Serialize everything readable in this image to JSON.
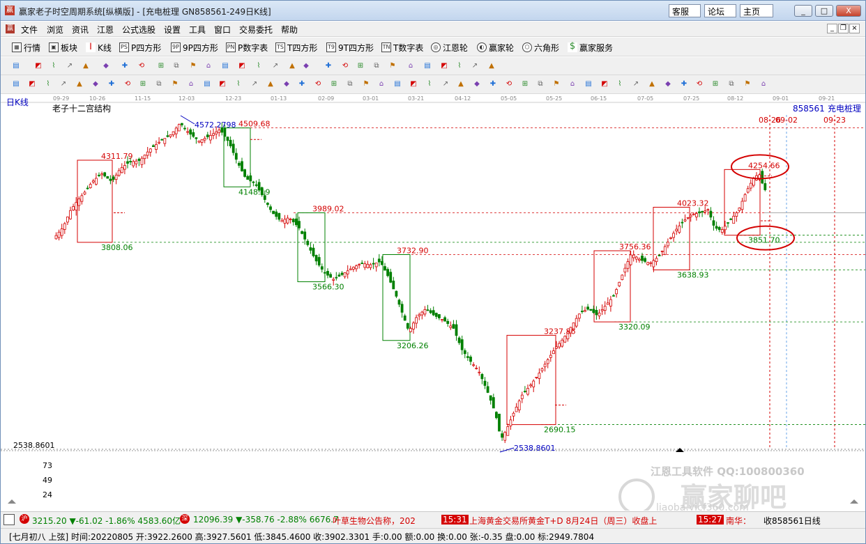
{
  "window": {
    "title": "赢家老子时空周期系统[纵横版] - [充电桩理   GN858561-249日K线]",
    "links": [
      "客服",
      "论坛",
      "主页"
    ],
    "controls": [
      "_",
      "□",
      "X"
    ]
  },
  "menu": [
    "文件",
    "浏览",
    "资讯",
    "江恩",
    "公式选股",
    "设置",
    "工具",
    "窗口",
    "交易委托",
    "帮助"
  ],
  "toolbar1": [
    {
      "label": "行情",
      "icon": "grid-icon"
    },
    {
      "label": "板块",
      "icon": "blocks-icon"
    },
    {
      "label": "K线",
      "icon": "candle-icon"
    },
    {
      "label": "P四方形",
      "icon": "ps-icon",
      "tag": "PS"
    },
    {
      "label": "9P四方形",
      "icon": "9p-icon",
      "tag": "9P"
    },
    {
      "label": "P数字表",
      "icon": "pn-icon",
      "tag": "PN"
    },
    {
      "label": "T四方形",
      "icon": "ts-icon",
      "tag": "TS"
    },
    {
      "label": "9T四方形",
      "icon": "9t-icon",
      "tag": "T9"
    },
    {
      "label": "T数字表",
      "icon": "tn-icon",
      "tag": "TN"
    },
    {
      "label": "江恩轮",
      "icon": "gann-wheel-icon",
      "tag": "◎"
    },
    {
      "label": "赢家轮",
      "icon": "winner-wheel-icon",
      "tag": "◐"
    },
    {
      "label": "六角形",
      "icon": "hexagon-icon",
      "tag": "⬡"
    },
    {
      "label": "赢家服务",
      "icon": "dollar-icon",
      "tag": "$"
    }
  ],
  "chart": {
    "period_label": "日K线",
    "indicator_title": "老子十二宫结构",
    "code": "858561",
    "name": "充电桩理",
    "date_ticks": [
      "09-29",
      "10-26",
      "11-15",
      "12-03",
      "12-23",
      "01-13",
      "02-09",
      "03-01",
      "03-21",
      "04-12",
      "05-05",
      "05-25",
      "06-15",
      "07-05",
      "07-25",
      "08-12",
      "09-01",
      "09-21"
    ],
    "future_dates": [
      "08-26",
      "09-02",
      "09-23"
    ],
    "y_bottom_label": "2538.8601",
    "sub_axis": [
      "73",
      "49",
      "24"
    ],
    "watermark1": "江恩工具软件  QQ:100800360",
    "watermark2": "赢家聊吧",
    "watermark3": "liaoba.yjcf360.com",
    "red_labels": [
      {
        "text": "4311.79"
      },
      {
        "text": "4509.68"
      },
      {
        "text": "3989.02"
      },
      {
        "text": "3732.90"
      },
      {
        "text": "3237.86"
      },
      {
        "text": "3756.36"
      },
      {
        "text": "4023.32"
      },
      {
        "text": "4254.66"
      }
    ],
    "green_labels": [
      {
        "text": "3808.06"
      },
      {
        "text": "4148.19"
      },
      {
        "text": "3566.30"
      },
      {
        "text": "3206.26"
      },
      {
        "text": "2690.15"
      },
      {
        "text": "3320.09"
      },
      {
        "text": "3638.93"
      },
      {
        "text": "3851.70"
      }
    ],
    "blue_labels": [
      {
        "text": "4572.2798"
      },
      {
        "text": "2538.8601"
      }
    ],
    "colors": {
      "up": "#d40000",
      "down": "#008000",
      "box_red": "#d40000",
      "box_green": "#008000",
      "blue": "#0000c0"
    }
  },
  "chart_data": {
    "type": "candlestick",
    "title": "老子十二宫结构",
    "ylim": [
      2538.8601,
      4572.2798
    ],
    "high": 4572.2798,
    "low": 2538.8601,
    "levels_resistance": [
      4311.79,
      4509.68,
      3989.02,
      3732.9,
      3237.86,
      3756.36,
      4023.32,
      4254.66
    ],
    "levels_support": [
      3808.06,
      4148.19,
      3566.3,
      3206.26,
      2690.15,
      3320.09,
      3638.93,
      3851.7
    ],
    "sub_axis_ticks": [
      73,
      49,
      24
    ]
  },
  "status": {
    "sh_tag": "沪",
    "sh": "3215.20 ▼-61.02 -1.86% 4583.60亿",
    "sz_tag": "深",
    "sz": "12096.39 ▼-358.76 -2.88% 6676.7",
    "news1": "叶草生物公告称，202",
    "time1": "15:31",
    "news2": "上海黄金交易所黄金T+D 8月24日（周三）收盘上",
    "time2": "15:27",
    "news3": "南华：",
    "quote": "收858561日线"
  },
  "infobar": "[七月初八  上弦] 时间:20220805 开:3922.2600 高:3927.5601 低:3845.4600 收:3902.3301 手:0.00 额:0.00 换:0.00 张:-0.35 盘:0.00 标:2949.7804"
}
